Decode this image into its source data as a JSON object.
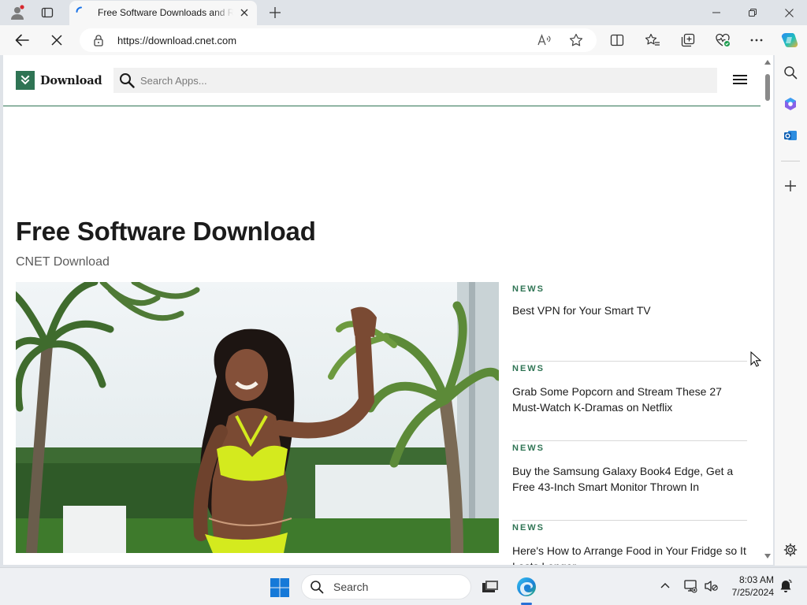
{
  "browser": {
    "tab": {
      "title": "Free Software Downloads and Reviews for Windows, Android, Mac, and iOS - CNET Download"
    },
    "address": {
      "url": "https://download.cnet.com"
    }
  },
  "site": {
    "logo_text": "Download",
    "search": {
      "placeholder": "Search Apps..."
    },
    "heading": "Free Software Download",
    "subheading": "CNET Download",
    "hero_alt": "Woman in a neon yellow swimsuit waving beside palm trees",
    "news": [
      {
        "tag": "NEWS",
        "title": "Best VPN for Your Smart TV"
      },
      {
        "tag": "NEWS",
        "title": "Grab Some Popcorn and Stream These 27 Must-Watch K-Dramas on Netflix"
      },
      {
        "tag": "NEWS",
        "title": "Buy the Samsung Galaxy Book4 Edge, Get a Free 43-Inch Smart Monitor Thrown In"
      },
      {
        "tag": "NEWS",
        "title": "Here's How to Arrange Food in Your Fridge so It Lasts Longer"
      }
    ],
    "accent_color": "#2f7454"
  },
  "taskbar": {
    "search_label": "Search",
    "time": "8:03 AM",
    "date": "7/25/2024"
  }
}
